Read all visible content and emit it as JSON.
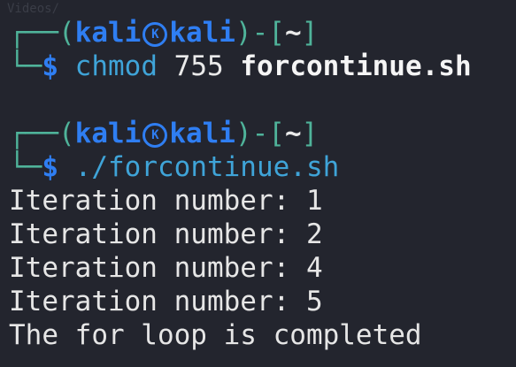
{
  "ghost_text": "Videos/",
  "colors": {
    "background": "#23252e",
    "prompt_box": "#4fb39a",
    "user": "#2f7ef2",
    "command": "#3fa4d8",
    "output": "#e6e6e6"
  },
  "prompts": [
    {
      "open": "┌──(",
      "user": "kali",
      "host": "kali",
      "close": ")-[",
      "dir": "~",
      "end": "]",
      "corner": "└─",
      "dollar": "$",
      "command": "chmod",
      "args": " 755 ",
      "file": "forcontinue.sh"
    },
    {
      "open": "┌──(",
      "user": "kali",
      "host": "kali",
      "close": ")-[",
      "dir": "~",
      "end": "]",
      "corner": "└─",
      "dollar": "$",
      "command": "./forcontinue.sh"
    }
  ],
  "output": [
    "Iteration number: 1",
    "Iteration number: 2",
    "Iteration number: 4",
    "Iteration number: 5",
    "The for loop is completed"
  ]
}
